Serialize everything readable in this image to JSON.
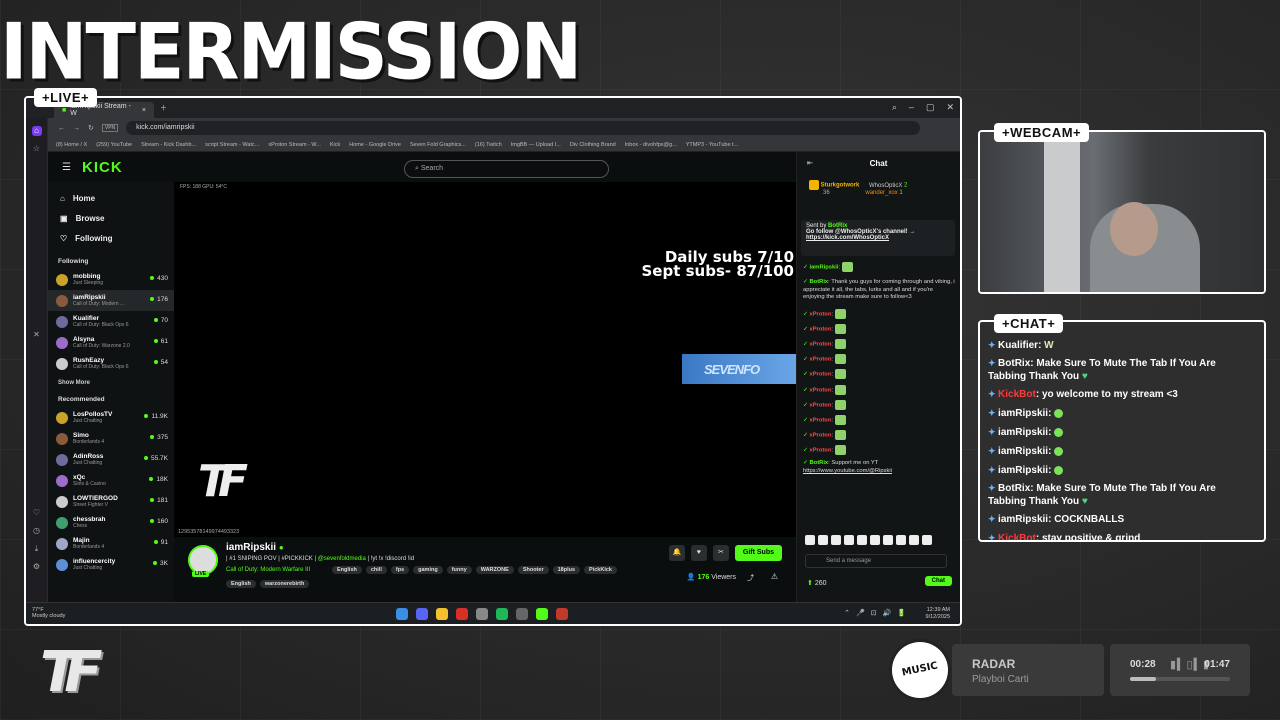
{
  "overlay": {
    "title": "INTERMISSION",
    "live_tag": "+LIVE+",
    "webcam_tag": "+WEBCAM+",
    "chat_tag": "+CHAT+"
  },
  "browser": {
    "tab_title": "iamRipskii Stream - W",
    "url": "kick.com/iamripskii",
    "bookmarks": [
      "(8) Home / X",
      "(259) YouTube",
      "Stream - Kick Dashb...",
      "script Stream - Watc...",
      "xProton Stream - W...",
      "Kick",
      "Home - Google Drive",
      "Seven Fold Graphics...",
      "(16) Twitch",
      "ImgBB — Upload I...",
      "Div Clothing Brand",
      "Inbox - divohfps@g...",
      "YTMP3 - YouTube t..."
    ]
  },
  "kick": {
    "logo": "KICK",
    "search_placeholder": "Search",
    "nav": [
      {
        "label": "Home",
        "icon": "home-icon"
      },
      {
        "label": "Browse",
        "icon": "browse-icon"
      },
      {
        "label": "Following",
        "icon": "heart-icon"
      }
    ],
    "following_label": "Following",
    "following": [
      {
        "name": "mobbing",
        "game": "Just Sleeping",
        "viewers": "430"
      },
      {
        "name": "iamRipskii",
        "game": "Call of Duty: Modern ...",
        "viewers": "176"
      },
      {
        "name": "Kualifier",
        "game": "Call of Duty: Black Ops 6",
        "viewers": "70"
      },
      {
        "name": "Alsyna",
        "game": "Call of Duty: Warzone 2.0",
        "viewers": "61"
      },
      {
        "name": "RushEazy",
        "game": "Call of Duty: Black Ops 6",
        "viewers": "54"
      }
    ],
    "show_more": "Show More",
    "recommended_label": "Recommended",
    "recommended": [
      {
        "name": "LosPollosTV",
        "game": "Just Chatting",
        "viewers": "11.9K"
      },
      {
        "name": "Simo",
        "game": "Borderlands 4",
        "viewers": "375"
      },
      {
        "name": "AdinRoss",
        "game": "Just Chatting",
        "viewers": "55.7K"
      },
      {
        "name": "xQc",
        "game": "Slots & Casino",
        "viewers": "18K"
      },
      {
        "name": "LOWTIERGOD",
        "game": "Street Fighter V",
        "viewers": "181"
      },
      {
        "name": "chessbrah",
        "game": "Chess",
        "viewers": "160"
      },
      {
        "name": "Majin",
        "game": "Borderlands 4",
        "viewers": "91"
      },
      {
        "name": "influencercity",
        "game": "Just Chatting",
        "viewers": "3K"
      }
    ],
    "player": {
      "fps_text": "FPS: 188  GPU: 54°C",
      "daily": "Daily subs 7/10",
      "sept": "Sept subs- 87/100",
      "banner": "SEVENFO",
      "logo": "TF",
      "id_text": "12953578149974493323"
    },
    "stream": {
      "streamer": "iamRipskii",
      "live_badge": "LIVE",
      "title_pre": "| #1 SNIPING POV | #PICKKICK | ",
      "title_handle": "@sevenfoldmedia",
      "title_post": " | !yt !x !discord !id",
      "game": "Call of Duty: Modern Warfare III",
      "tags": [
        "English",
        "chill",
        "fps",
        "gaming",
        "funny",
        "WARZONE",
        "Shooter",
        "18plus",
        "PickKick"
      ],
      "tags2": [
        "English",
        "warzonerebirth"
      ],
      "gift_label": "Gift Subs",
      "viewers": "176",
      "viewers_label": "Viewers"
    },
    "chat": {
      "title": "Chat",
      "leader": {
        "first": "Sturkgotwork",
        "first_count": "36",
        "second": "WhosOpticX",
        "second_count": "2",
        "third": "wander_xox",
        "third_count": "1"
      },
      "pinned": {
        "sent_by": "Sent by",
        "bot": "BotRix",
        "text": "Go follow @WhosOpticX's channel! →",
        "link": "https://kick.com/WhosOpticX"
      },
      "messages": [
        {
          "user": "iamRipskii",
          "text": ""
        },
        {
          "user": "BotRix",
          "text": "Thank you guys for coming through and vibing, i appreciate it all, the tabs, lurks and all and if you're enjoying the stream make sure to follow<3"
        },
        {
          "user": "xProton",
          "text": ""
        },
        {
          "user": "xProton",
          "text": ""
        },
        {
          "user": "xProton",
          "text": ""
        },
        {
          "user": "xProton",
          "text": ""
        },
        {
          "user": "xProton",
          "text": ""
        },
        {
          "user": "xProton",
          "text": ""
        },
        {
          "user": "xProton",
          "text": ""
        },
        {
          "user": "xProton",
          "text": ""
        },
        {
          "user": "xProton",
          "text": ""
        },
        {
          "user": "xProton",
          "text": ""
        },
        {
          "user": "BotRix",
          "text": "Support me on YT",
          "link": "https://www.youtube.com/@Ripskii"
        }
      ],
      "send_placeholder": "Send a message",
      "points": "260",
      "chat_button": "Chat"
    }
  },
  "taskbar": {
    "temp": "77°F",
    "weather": "Mostly cloudy",
    "time": "12:39 AM",
    "date": "9/12/2025"
  },
  "overlay_chat": [
    {
      "user": "Kualifier",
      "text": "W",
      "style": "gn"
    },
    {
      "user": "BotRix",
      "text": "Make Sure To Mute The Tab If You Are Tabbing Thank You",
      "style": "gn",
      "wrap": true
    },
    {
      "user": "KickBot",
      "text": "yo welcome to my stream <3",
      "style": "rd"
    },
    {
      "user": "iamRipskii",
      "text": "",
      "style": "gn"
    },
    {
      "user": "iamRipskii",
      "text": "",
      "style": "gn"
    },
    {
      "user": "iamRipskii",
      "text": "",
      "style": "gn"
    },
    {
      "user": "iamRipskii",
      "text": "",
      "style": "gn"
    },
    {
      "user": "BotRix",
      "text": "Make Sure To Mute The Tab If You Are Tabbing Thank You",
      "style": "gn",
      "wrap": true
    },
    {
      "user": "iamRipskii",
      "text": "COCKNBALLS",
      "style": "gn"
    },
    {
      "user": "KickBot",
      "text": "stay positive & grind",
      "style": "rd"
    }
  ],
  "music": {
    "title": "RADAR",
    "artist": "Playboi Carti",
    "elapsed": "00:28",
    "total": "01:47",
    "progress": 0.26,
    "vinyl_text": "MUSIC"
  },
  "colors": {
    "kick_green": "#53fc18",
    "bot_red": "#ff3b3b"
  }
}
